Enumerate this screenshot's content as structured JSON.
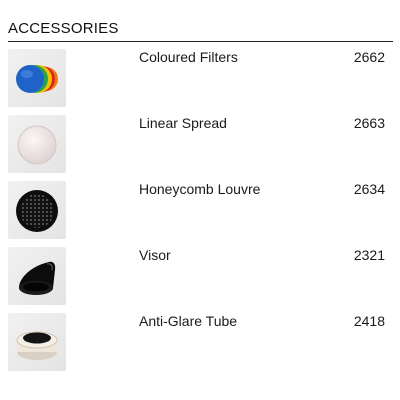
{
  "section": {
    "title": "ACCESSORIES"
  },
  "items": [
    {
      "name": "Coloured Filters",
      "code": "2662",
      "icon": "coloured-filters-icon"
    },
    {
      "name": "Linear Spread",
      "code": "2663",
      "icon": "linear-spread-icon"
    },
    {
      "name": "Honeycomb Louvre",
      "code": "2634",
      "icon": "honeycomb-louvre-icon"
    },
    {
      "name": "Visor",
      "code": "2321",
      "icon": "visor-icon"
    },
    {
      "name": "Anti-Glare Tube",
      "code": "2418",
      "icon": "anti-glare-tube-icon"
    }
  ],
  "colors": {
    "filter_blue": "#1f63c9",
    "filter_green": "#2ea24a",
    "filter_yellow": "#f2c200",
    "filter_red": "#d8261f",
    "filter_orange": "#f07a12"
  }
}
